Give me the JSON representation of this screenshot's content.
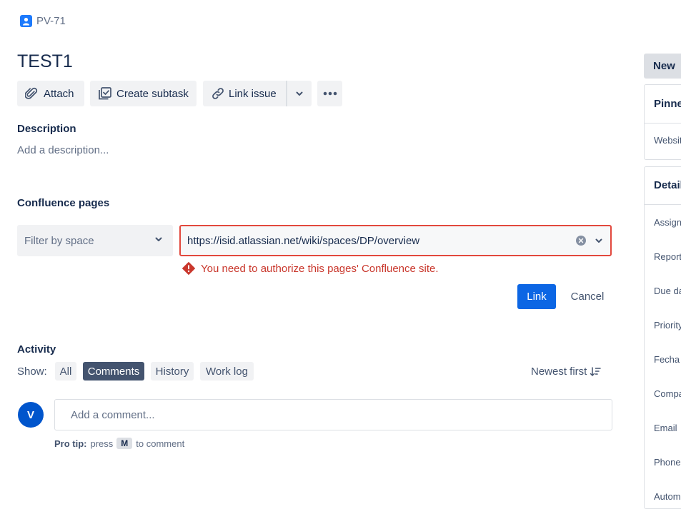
{
  "breadcrumb": {
    "issue_key": "PV-71"
  },
  "issue": {
    "title": "TEST1"
  },
  "toolbar": {
    "attach_label": "Attach",
    "create_subtask_label": "Create subtask",
    "link_issue_label": "Link issue"
  },
  "description": {
    "heading": "Description",
    "placeholder": "Add a description..."
  },
  "confluence": {
    "heading": "Confluence pages",
    "filter_placeholder": "Filter by space",
    "url_value": "https://isid.atlassian.net/wiki/spaces/DP/overview",
    "error_text": "You need to authorize this pages' Confluence site.",
    "link_button": "Link",
    "cancel_button": "Cancel"
  },
  "activity": {
    "heading": "Activity",
    "show_label": "Show:",
    "filters": [
      "All",
      "Comments",
      "History",
      "Work log"
    ],
    "active_filter": "Comments",
    "sort_label": "Newest first",
    "avatar_initial": "V",
    "comment_placeholder": "Add a comment...",
    "pro_tip_bold": "Pro tip:",
    "pro_tip_press": "press",
    "pro_tip_key": "M",
    "pro_tip_rest": "to comment"
  },
  "right_panel": {
    "status_button": "New",
    "pinned_heading": "Pinne",
    "pinned_item": "Websit",
    "details_heading": "Detail",
    "fields": [
      "Assign",
      "Report",
      "Due da",
      "Priority",
      "Fecha",
      "Compa",
      "Email",
      "Phone",
      "Autom"
    ]
  },
  "colors": {
    "primary": "#0C66E4",
    "error": "#C9372C",
    "error_border": "#E2483D",
    "active_pill": "#44546F",
    "avatar": "#0055CC"
  }
}
